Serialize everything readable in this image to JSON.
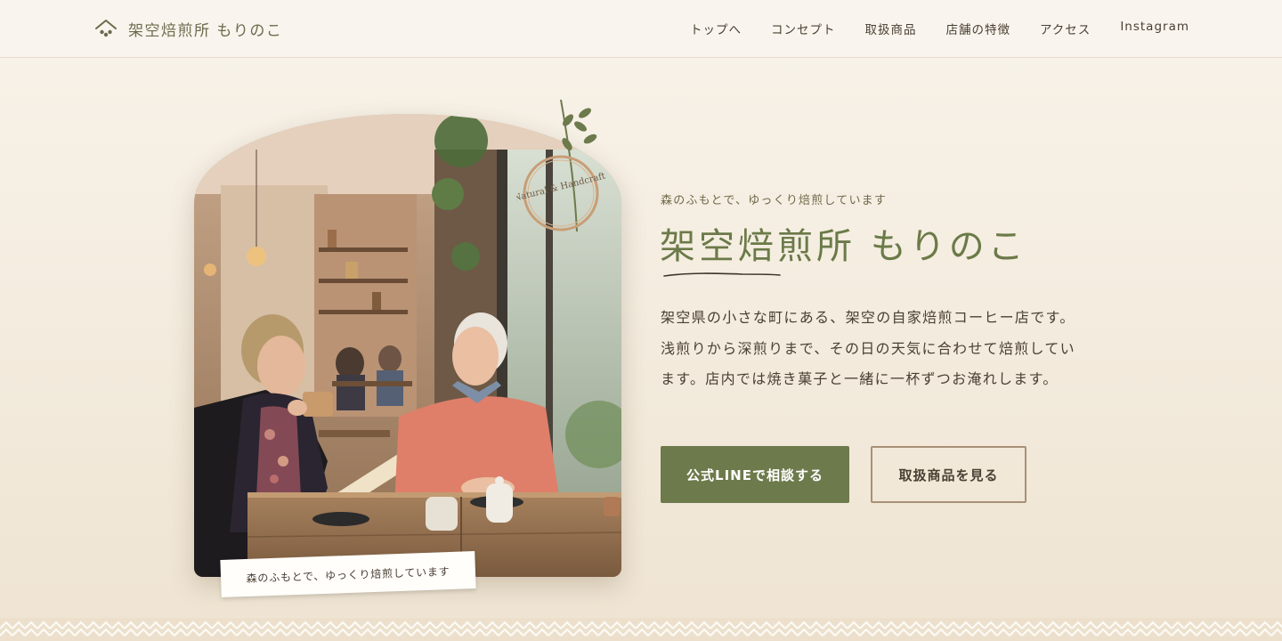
{
  "header": {
    "brand_name": "架空焙煎所 もりのこ",
    "nav": [
      "トップへ",
      "コンセプト",
      "取扱商品",
      "店舗の特徴",
      "アクセス",
      "Instagram"
    ]
  },
  "hero": {
    "badge_text": "Natural & Handcraft",
    "caption": "森のふもとで、ゆっくり焙煎しています",
    "tagline": "森のふもとで、ゆっくり焙煎しています",
    "title": "架空焙煎所 もりのこ",
    "description": "架空県の小さな町にある、架空の自家焙煎コーヒー店です。浅煎りから深煎りまで、その日の天気に合わせて焙煎しています。店内では焼き菓子と一緒に一杯ずつお淹れします。",
    "primary_button": "公式LINEで相談する",
    "secondary_button": "取扱商品を見る"
  },
  "colors": {
    "accent_green": "#6d7a4b",
    "button_border": "#a89177",
    "text": "#4a3f33",
    "background": "#f4ecdf"
  }
}
